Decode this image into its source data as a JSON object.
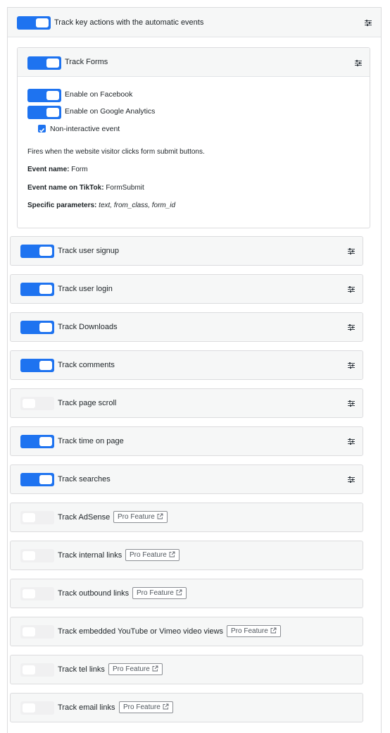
{
  "main_toggle": {
    "label": "Track key actions with the automatic events",
    "on": true
  },
  "forms": {
    "label": "Track Forms",
    "on": true,
    "enable_facebook": "Enable on Facebook",
    "enable_ga": "Enable on Google Analytics",
    "non_interactive": "Non-interactive event",
    "description": "Fires when the website visitor clicks form submit buttons.",
    "event_name_label": "Event name:",
    "event_name_value": "Form",
    "tiktok_label": "Event name on TikTok:",
    "tiktok_value": "FormSubmit",
    "params_label": "Specific parameters:",
    "params_value": "text, from_class, form_id"
  },
  "events": [
    {
      "label": "Track user signup",
      "on": true
    },
    {
      "label": "Track user login",
      "on": true
    },
    {
      "label": "Track Downloads",
      "on": true
    },
    {
      "label": "Track comments",
      "on": true
    },
    {
      "label": "Track page scroll",
      "on": false
    },
    {
      "label": "Track time on page",
      "on": true
    },
    {
      "label": "Track searches",
      "on": true
    }
  ],
  "pro_events": [
    {
      "label": "Track AdSense"
    },
    {
      "label": "Track internal links"
    },
    {
      "label": "Track outbound links"
    },
    {
      "label": "Track embedded YouTube or Vimeo video views"
    },
    {
      "label": "Track tel links"
    },
    {
      "label": "Track email links"
    }
  ],
  "pro_badge": "Pro Feature",
  "colors": {
    "accent": "#1e73f0",
    "off": "#f0f0f1",
    "card_bg": "#f6f7f7",
    "border": "#dcdcde"
  }
}
